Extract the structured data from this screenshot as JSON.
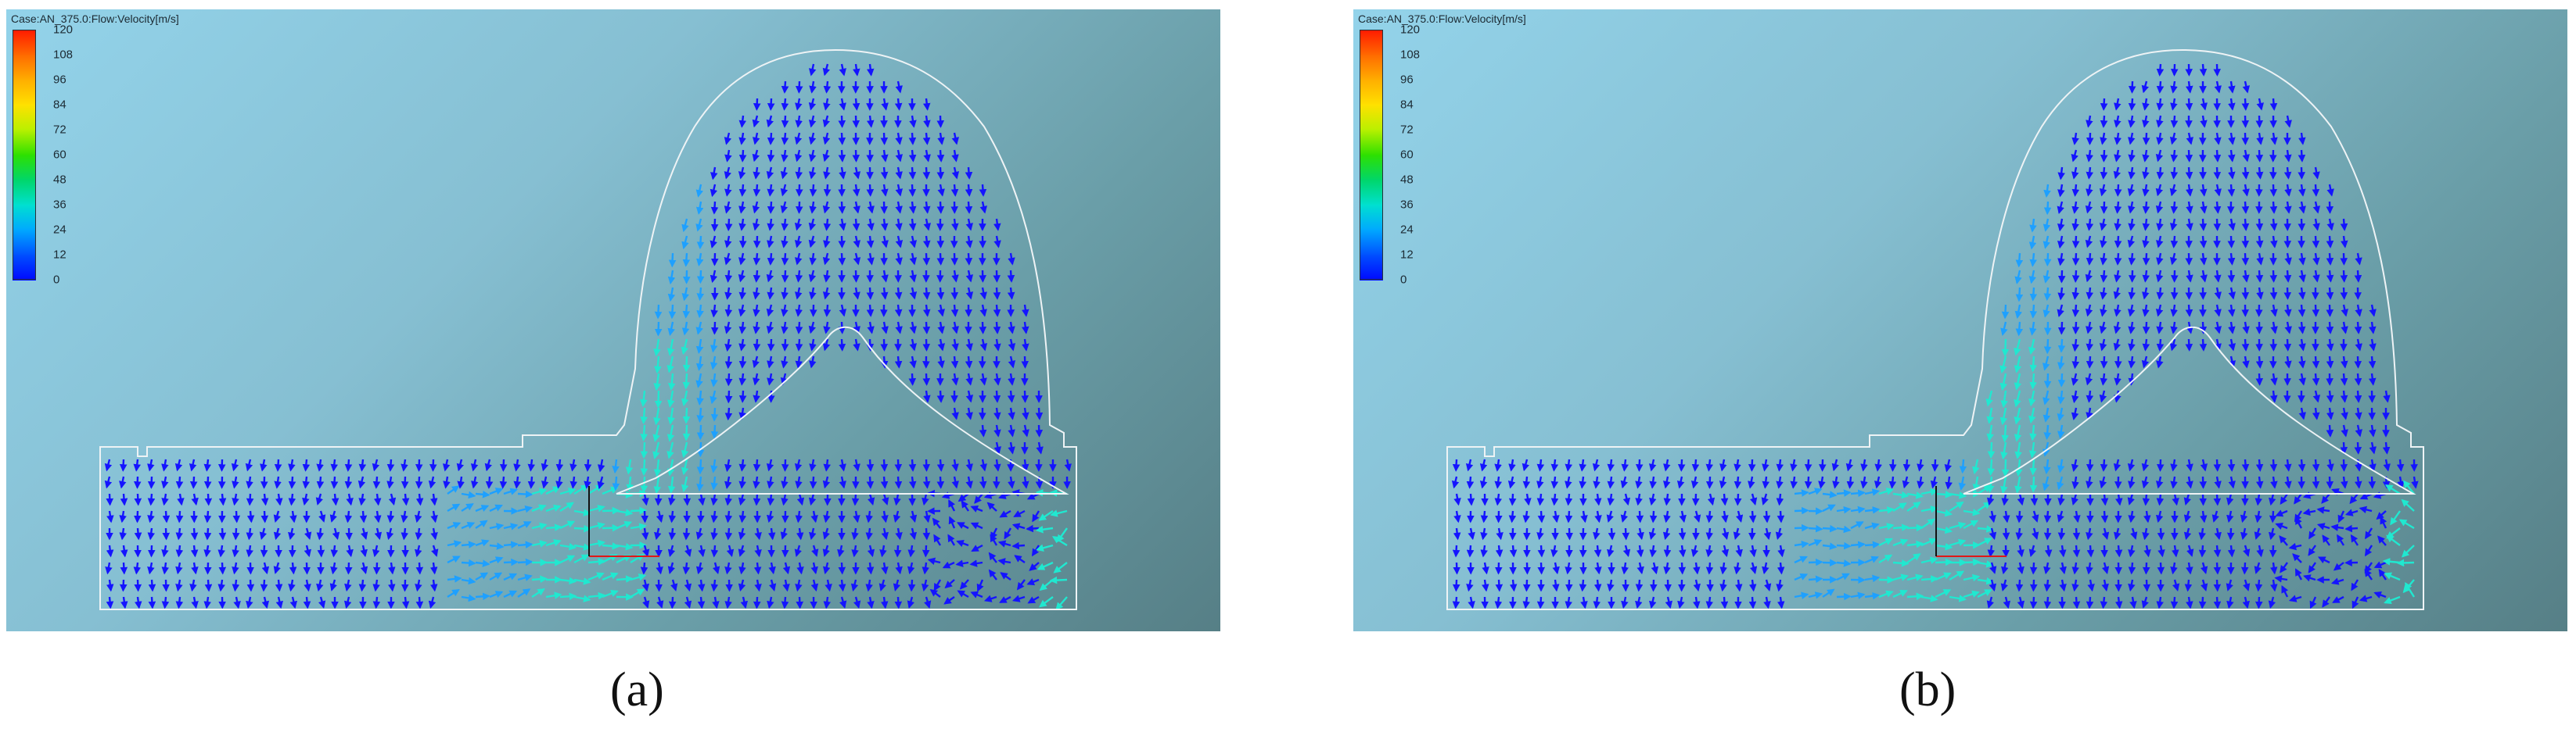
{
  "panels": [
    {
      "id": "a",
      "case_label": "Case:AN_375.0:Flow:Velocity[m/s]",
      "sub_label": "(a)"
    },
    {
      "id": "b",
      "case_label": "Case:AN_375.0:Flow:Velocity[m/s]",
      "sub_label": "(b)"
    }
  ],
  "colorbar": {
    "ticks": [
      "120",
      "108",
      "96",
      "84",
      "72",
      "60",
      "48",
      "36",
      "24",
      "12",
      "0"
    ],
    "colors": [
      "#ff1a00",
      "#ff6a00",
      "#ffae00",
      "#ffe100",
      "#b8f000",
      "#2ee000",
      "#00d66a",
      "#00e0d0",
      "#00a8ff",
      "#0050ff",
      "#0008ff"
    ]
  },
  "field_colors": {
    "low": "#1414ff",
    "mid": "#1ea0ff",
    "high": "#20e8d0",
    "peak": "#40f040"
  }
}
